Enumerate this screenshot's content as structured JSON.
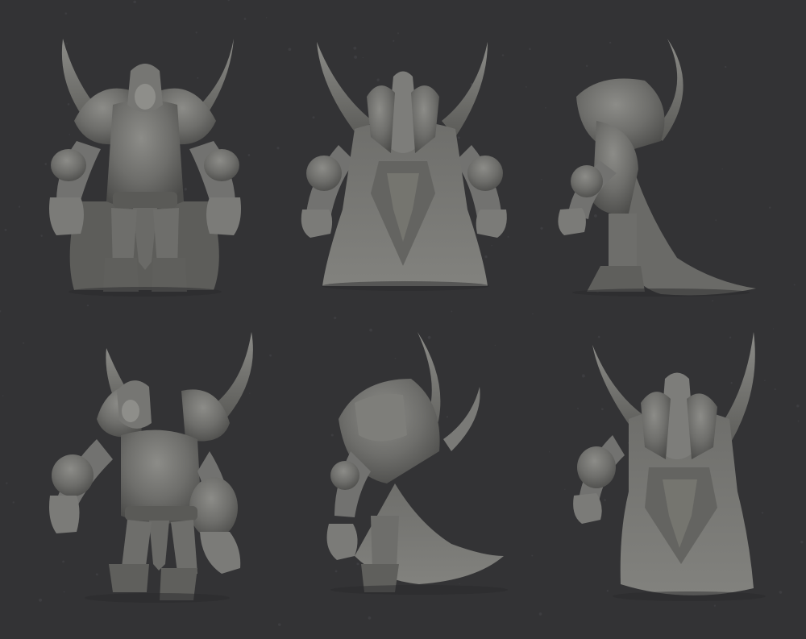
{
  "sheet": {
    "background": "#333335",
    "speck_color": "#3d3d40",
    "model_colors": {
      "base": "#6e6e6b",
      "mid": "#7a7a77",
      "light": "#8c8c88",
      "shadow": "#4c4c4a",
      "deep": "#3e3e3c"
    },
    "views": [
      {
        "name": "front-view-figure",
        "angle": "front"
      },
      {
        "name": "back-view-figure",
        "angle": "back"
      },
      {
        "name": "side-view-figure",
        "angle": "side"
      },
      {
        "name": "three-quarter-front-figure",
        "angle": "three-quarter-front"
      },
      {
        "name": "three-quarter-side-figure",
        "angle": "three-quarter-side"
      },
      {
        "name": "three-quarter-back-figure",
        "angle": "three-quarter-back"
      }
    ]
  }
}
